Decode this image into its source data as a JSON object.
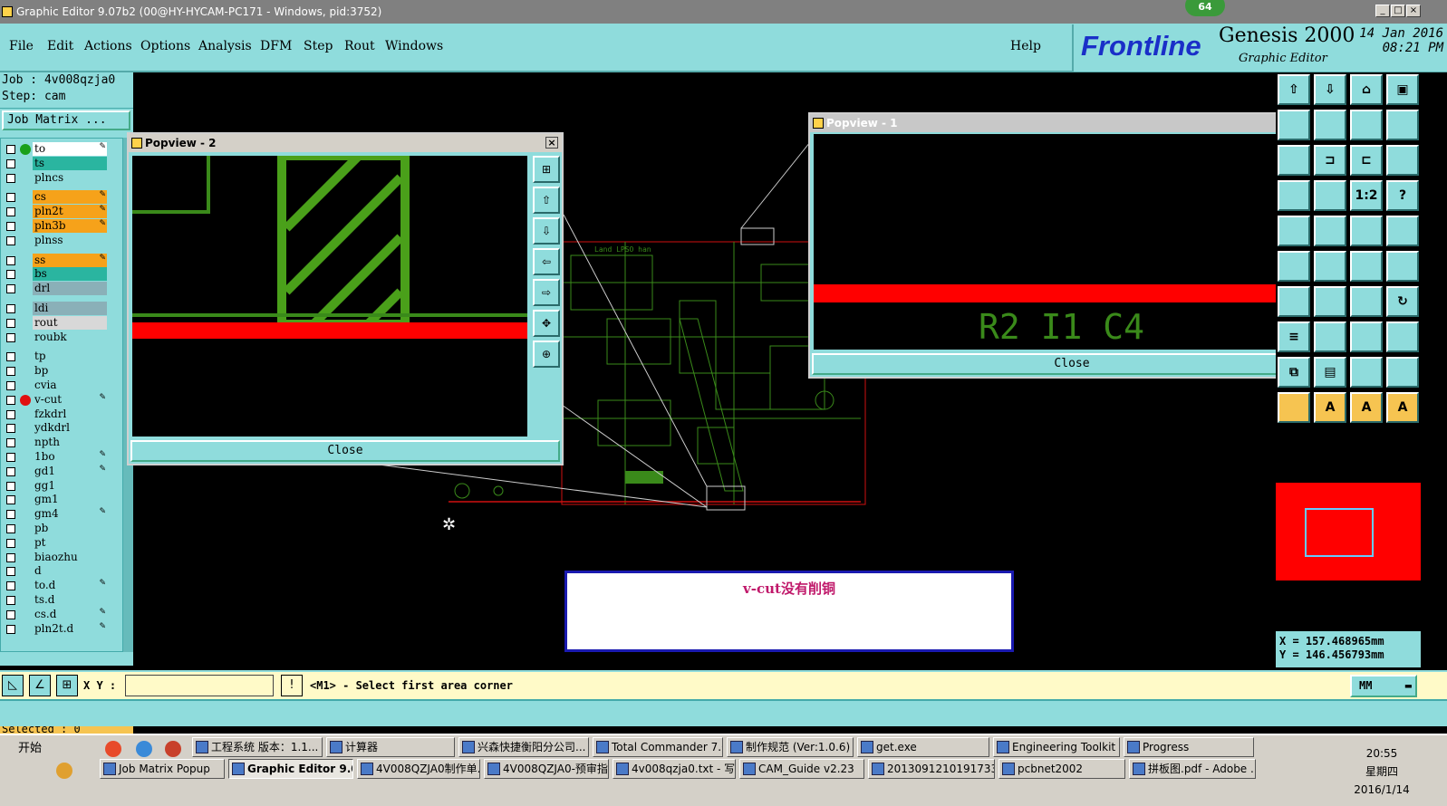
{
  "titlebar": {
    "title": "Graphic Editor 9.07b2 (00@HY-HYCAM-PC171 - Windows, pid:3752)",
    "badge": "64",
    "min": "_",
    "max": "□",
    "close": "×"
  },
  "menu": {
    "items": [
      "File",
      "Edit",
      "Actions",
      "Options",
      "Analysis",
      "DFM",
      "Step",
      "Rout",
      "Windows"
    ],
    "help": "Help"
  },
  "brand": {
    "logo": "Frontline",
    "product": "Genesis 2000",
    "subtitle": "Graphic Editor",
    "date": "14 Jan 2016",
    "time": "08:21 PM"
  },
  "job": {
    "job_line": "Job : 4v008qzja0",
    "step_line": "Step: cam",
    "matrix_button": "Job Matrix ..."
  },
  "layers": [
    {
      "name": "to",
      "color": "#ffffff",
      "dot": "#1aa01a",
      "edit": true
    },
    {
      "name": "ts",
      "color": "#2ab5a0",
      "dot": "",
      "edit": false
    },
    {
      "name": "plncs",
      "color": "#8fdcdc",
      "dot": "",
      "edit": false
    },
    {
      "name": "cs",
      "color": "#f6a21a",
      "dot": "",
      "edit": true
    },
    {
      "name": "pln2t",
      "color": "#f6a21a",
      "dot": "",
      "edit": true
    },
    {
      "name": "pln3b",
      "color": "#f6a21a",
      "dot": "",
      "edit": true
    },
    {
      "name": "plnss",
      "color": "#8fdcdc",
      "dot": "",
      "edit": false
    },
    {
      "name": "ss",
      "color": "#f6a21a",
      "dot": "",
      "edit": true
    },
    {
      "name": "bs",
      "color": "#2ab5a0",
      "dot": "",
      "edit": false
    },
    {
      "name": "drl",
      "color": "#8ab0b8",
      "dot": "",
      "edit": false
    },
    {
      "name": "ldi",
      "color": "#8ab0b8",
      "dot": "",
      "edit": false
    },
    {
      "name": "rout",
      "color": "#d8d8d8",
      "dot": "",
      "edit": false
    },
    {
      "name": "roubk",
      "color": "#8fdcdc",
      "dot": "",
      "edit": false
    },
    {
      "name": "tp",
      "color": "#8fdcdc",
      "dot": "",
      "edit": false
    },
    {
      "name": "bp",
      "color": "#8fdcdc",
      "dot": "",
      "edit": false
    },
    {
      "name": "cvia",
      "color": "#8fdcdc",
      "dot": "",
      "edit": false
    },
    {
      "name": "v-cut",
      "color": "#8fdcdc",
      "dot": "#e01010",
      "edit": true
    },
    {
      "name": "fzkdrl",
      "color": "#8fdcdc",
      "dot": "",
      "edit": false
    },
    {
      "name": "ydkdrl",
      "color": "#8fdcdc",
      "dot": "",
      "edit": false
    },
    {
      "name": "npth",
      "color": "#8fdcdc",
      "dot": "",
      "edit": false
    },
    {
      "name": "1bo",
      "color": "#8fdcdc",
      "dot": "",
      "edit": true
    },
    {
      "name": "gd1",
      "color": "#8fdcdc",
      "dot": "",
      "edit": true
    },
    {
      "name": "gg1",
      "color": "#8fdcdc",
      "dot": "",
      "edit": false
    },
    {
      "name": "gm1",
      "color": "#8fdcdc",
      "dot": "",
      "edit": false
    },
    {
      "name": "gm4",
      "color": "#8fdcdc",
      "dot": "",
      "edit": true
    },
    {
      "name": "pb",
      "color": "#8fdcdc",
      "dot": "",
      "edit": false
    },
    {
      "name": "pt",
      "color": "#8fdcdc",
      "dot": "",
      "edit": false
    },
    {
      "name": "biaozhu",
      "color": "#8fdcdc",
      "dot": "",
      "edit": false
    },
    {
      "name": "d",
      "color": "#8fdcdc",
      "dot": "",
      "edit": false
    },
    {
      "name": "to.d",
      "color": "#8fdcdc",
      "dot": "",
      "edit": true
    },
    {
      "name": "ts.d",
      "color": "#8fdcdc",
      "dot": "",
      "edit": false
    },
    {
      "name": "cs.d",
      "color": "#8fdcdc",
      "dot": "",
      "edit": true
    },
    {
      "name": "pln2t.d",
      "color": "#8fdcdc",
      "dot": "",
      "edit": true
    }
  ],
  "selected": "Selected : 0",
  "popup2": {
    "title": "Popview - 2",
    "close": "Close"
  },
  "popup1": {
    "title": "Popview - 1",
    "close": "Close",
    "silk": "R2  I1   C4"
  },
  "board": {
    "label": "Land LPSO han"
  },
  "note": "v-cut没有削铜",
  "coords": {
    "x": "X  =  157.468965mm",
    "y": "Y  =  146.456793mm"
  },
  "cmd": {
    "xy_label": "X Y :",
    "xy_value": "",
    "prompt": "<M1> - Select first area corner",
    "units": "MM"
  },
  "tools": [
    "⇧",
    "⇩",
    "⌂",
    "▣",
    "",
    "",
    "",
    "",
    "",
    "⊐",
    "⊏",
    "",
    "",
    "",
    "1:2",
    "?",
    "",
    "",
    "",
    "",
    "",
    "",
    "",
    "",
    "",
    "",
    "",
    "↻",
    "≡",
    "",
    "",
    "",
    "⧉",
    "▤",
    "",
    "",
    "",
    "A",
    "A",
    "A",
    "↖",
    "↖",
    "↖",
    "⤭"
  ],
  "taskbar": {
    "start": "开始",
    "row1": [
      "工程系统  版本：1.1...",
      "计算器",
      "兴森快捷衡阳分公司...",
      "Total Commander 7.0 ...",
      "制作规范 (Ver:1.0.6)",
      "get.exe",
      "Engineering Toolkit 9....",
      "Progress"
    ],
    "row2": [
      "Job Matrix Popup",
      "Graphic Editor 9.07...",
      "4V008QZJA0制作单....",
      "4V008QZJA0-预审指...",
      "4v008qzja0.txt - 写...",
      "CAM_Guide v2.23",
      "20130912101917336...",
      "pcbnet2002",
      "拼板图.pdf - Adobe ..."
    ],
    "clock_time": "20:55",
    "clock_day": "星期四",
    "clock_date": "2016/1/14"
  }
}
